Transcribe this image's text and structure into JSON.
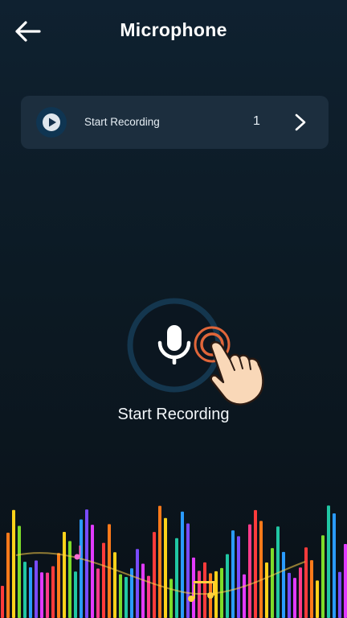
{
  "header": {
    "title": "Microphone",
    "back_icon": "arrow-left-icon"
  },
  "recording_card": {
    "label": "Start Recording",
    "count": "1",
    "play_icon": "play-circle-icon",
    "chevron_icon": "chevron-right-icon"
  },
  "mic": {
    "icon": "microphone-icon",
    "label": "Start Recording",
    "hint_icon": "tap-hand-icon"
  },
  "colors": {
    "background": "#0c1a24",
    "card": "#1c2e3e",
    "ring": "#14364e",
    "tap_ring": "#e0663a"
  }
}
